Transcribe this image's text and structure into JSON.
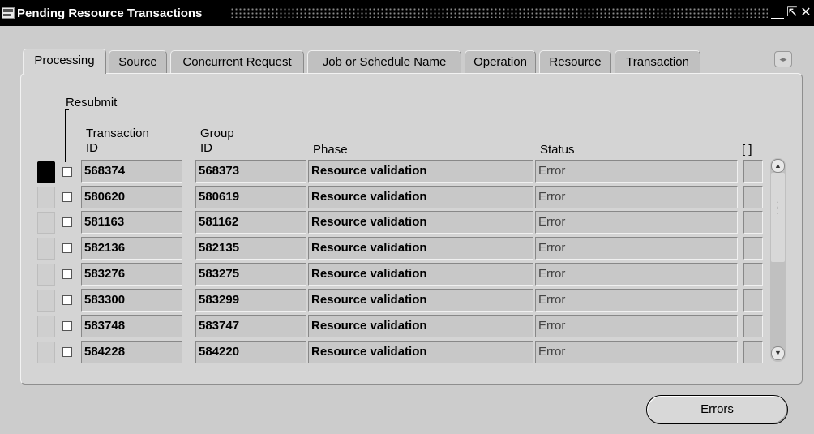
{
  "window": {
    "title": "Pending Resource Transactions",
    "buttons": {
      "minimize": "⎽",
      "restore": "⇱",
      "close": "✕"
    }
  },
  "tabs": [
    {
      "label": "Processing",
      "active": true
    },
    {
      "label": "Source",
      "active": false
    },
    {
      "label": "Concurrent Request",
      "active": false
    },
    {
      "label": "Job or Schedule Name",
      "active": false
    },
    {
      "label": "Operation",
      "active": false
    },
    {
      "label": "Resource",
      "active": false
    },
    {
      "label": "Transaction",
      "active": false
    }
  ],
  "tab_scroll_glyph": "◂▸",
  "table": {
    "resubmit_label": "Resubmit",
    "columns": {
      "transaction_id": [
        "Transaction",
        "ID"
      ],
      "group_id": [
        "Group",
        "ID"
      ],
      "phase": "Phase",
      "status": "Status",
      "extra": "[  ]"
    },
    "rows": [
      {
        "transaction_id": "568374",
        "group_id": "568373",
        "phase": "Resource validation",
        "status": "Error",
        "resubmit": false
      },
      {
        "transaction_id": "580620",
        "group_id": "580619",
        "phase": "Resource validation",
        "status": "Error",
        "resubmit": false
      },
      {
        "transaction_id": "581163",
        "group_id": "581162",
        "phase": "Resource validation",
        "status": "Error",
        "resubmit": false
      },
      {
        "transaction_id": "582136",
        "group_id": "582135",
        "phase": "Resource validation",
        "status": "Error",
        "resubmit": false
      },
      {
        "transaction_id": "583276",
        "group_id": "583275",
        "phase": "Resource validation",
        "status": "Error",
        "resubmit": false
      },
      {
        "transaction_id": "583300",
        "group_id": "583299",
        "phase": "Resource validation",
        "status": "Error",
        "resubmit": false
      },
      {
        "transaction_id": "583748",
        "group_id": "583747",
        "phase": "Resource validation",
        "status": "Error",
        "resubmit": false
      },
      {
        "transaction_id": "584228",
        "group_id": "584220",
        "phase": "Resource validation",
        "status": "Error",
        "resubmit": false
      }
    ]
  },
  "scrollbar": {
    "up": "▲",
    "down": "▼"
  },
  "buttons": {
    "errors": "Errors"
  }
}
